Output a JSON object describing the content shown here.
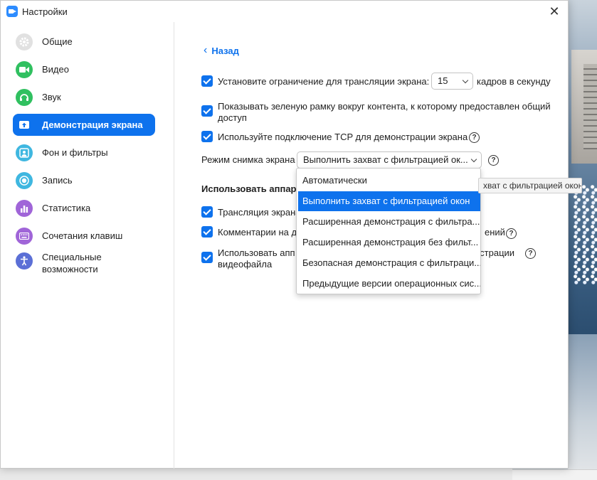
{
  "window": {
    "title": "Настройки"
  },
  "sidebar": {
    "items": [
      {
        "label": "Общие",
        "icon": "gear-icon",
        "color": "#e1e1e1"
      },
      {
        "label": "Видео",
        "icon": "video-camera-icon",
        "color": "#30c060"
      },
      {
        "label": "Звук",
        "icon": "headphones-icon",
        "color": "#30c060"
      },
      {
        "label": "Демонстрация экрана",
        "icon": "share-screen-icon",
        "color": "#0e72ed",
        "active": true
      },
      {
        "label": "Фон и фильтры",
        "icon": "background-person-icon",
        "color": "#3fb7e0"
      },
      {
        "label": "Запись",
        "icon": "record-icon",
        "color": "#3fb7e0"
      },
      {
        "label": "Статистика",
        "icon": "statistics-icon",
        "color": "#a065d8"
      },
      {
        "label": "Сочетания клавиш",
        "icon": "keyboard-icon",
        "color": "#a065d8"
      },
      {
        "label": "Специальные возможности",
        "line1": "Специальные",
        "line2": "возможности",
        "icon": "accessibility-icon",
        "color": "#5b6fd6"
      }
    ]
  },
  "main": {
    "back_label": "Назад",
    "limit_fps": {
      "label": "Установите ограничение для трансляции экрана:",
      "value": "15",
      "suffix": "кадров в секунду",
      "checked": true
    },
    "green_border": {
      "line1": "Показывать зеленую рамку вокруг контента, к которому предоставлен общий",
      "line2": "доступ",
      "checked": true
    },
    "tcp": {
      "label": "Используйте подключение TCP для демонстрации экрана",
      "checked": true
    },
    "capture_mode": {
      "label": "Режим снимка экрана",
      "value": "Выполнить захват с фильтрацией ок..."
    },
    "hw_section": "Использовать аппар",
    "hw_items": [
      {
        "label": "Трансляция экрана",
        "checked": true
      },
      {
        "label": "Комментарии на д",
        "suffix": "ений",
        "checked": true
      },
      {
        "line1": "Использовать апп",
        "line1_suffix": "нстрации",
        "line2": "видеофайла",
        "checked": true
      }
    ]
  },
  "dropdown": {
    "options": [
      "Автоматически",
      "Выполнить захват с фильтрацией окон",
      "Расширенная демонстрация с фильтра...",
      "Расширенная демонстрация без фильт...",
      "Безопасная демонстрация с фильтраци...",
      "Предыдущие версии операционных сис..."
    ],
    "selected_index": 1
  },
  "tooltip": {
    "text": "хват с фильтрацией окон"
  },
  "colors": {
    "accent": "#0e72ed"
  }
}
